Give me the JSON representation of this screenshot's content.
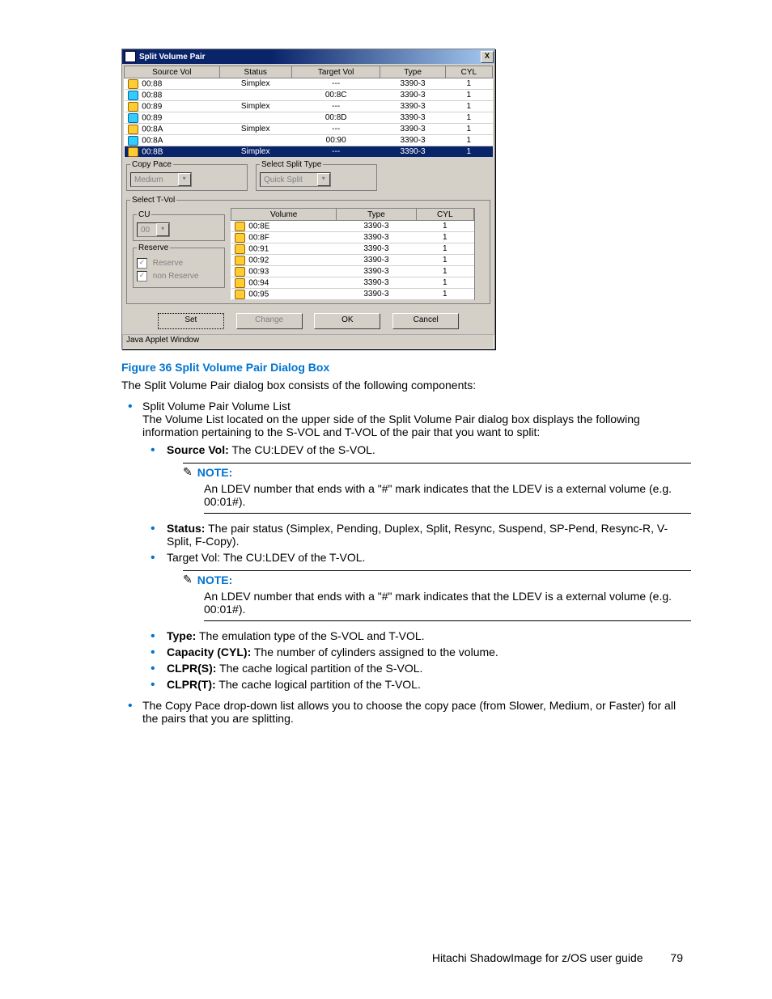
{
  "dialog": {
    "title": "Split Volume Pair",
    "close_x": "X",
    "statusbar": "Java Applet Window",
    "top_headers": [
      "Source Vol",
      "Status",
      "Target Vol",
      "Type",
      "CYL"
    ],
    "top_rows": [
      {
        "icon": "y",
        "src": "00:88",
        "status": "Simplex",
        "tgt": "---",
        "type": "3390-3",
        "cyl": "1",
        "sel": false
      },
      {
        "icon": "b",
        "src": "00:88",
        "status": "",
        "tgt": "00:8C",
        "type": "3390-3",
        "cyl": "1",
        "sel": false
      },
      {
        "icon": "y",
        "src": "00:89",
        "status": "Simplex",
        "tgt": "---",
        "type": "3390-3",
        "cyl": "1",
        "sel": false
      },
      {
        "icon": "b",
        "src": "00:89",
        "status": "",
        "tgt": "00:8D",
        "type": "3390-3",
        "cyl": "1",
        "sel": false
      },
      {
        "icon": "y",
        "src": "00:8A",
        "status": "Simplex",
        "tgt": "---",
        "type": "3390-3",
        "cyl": "1",
        "sel": false
      },
      {
        "icon": "b",
        "src": "00:8A",
        "status": "",
        "tgt": "00:90",
        "type": "3390-3",
        "cyl": "1",
        "sel": false
      },
      {
        "icon": "y",
        "src": "00:8B",
        "status": "Simplex",
        "tgt": "---",
        "type": "3390-3",
        "cyl": "1",
        "sel": true
      }
    ],
    "copy_pace": {
      "legend": "Copy Pace",
      "value": "Medium"
    },
    "split_type": {
      "legend": "Select Split Type",
      "value": "Quick Split"
    },
    "select_tvol_legend": "Select T-Vol",
    "cu": {
      "legend": "CU",
      "value": "00"
    },
    "reserve": {
      "legend": "Reserve",
      "opt1": "Reserve",
      "opt2": "non Reserve"
    },
    "vol_headers": [
      "Volume",
      "Type",
      "CYL"
    ],
    "vol_rows": [
      {
        "v": "00:8E",
        "t": "3390-3",
        "c": "1"
      },
      {
        "v": "00:8F",
        "t": "3390-3",
        "c": "1"
      },
      {
        "v": "00:91",
        "t": "3390-3",
        "c": "1"
      },
      {
        "v": "00:92",
        "t": "3390-3",
        "c": "1"
      },
      {
        "v": "00:93",
        "t": "3390-3",
        "c": "1"
      },
      {
        "v": "00:94",
        "t": "3390-3",
        "c": "1"
      },
      {
        "v": "00:95",
        "t": "3390-3",
        "c": "1"
      }
    ],
    "buttons": {
      "set": "Set",
      "change": "Change",
      "ok": "OK",
      "cancel": "Cancel"
    }
  },
  "doc": {
    "fig_caption": "Figure 36 Split Volume Pair Dialog Box",
    "intro": "The Split Volume Pair dialog box consists of the following components:",
    "b1_item1_l1": "Split Volume Pair Volume List",
    "b1_item1_l2": "The Volume List located on the upper side of the Split Volume Pair dialog box displays the following information pertaining to the S-VOL and T-VOL of the pair that you want to split:",
    "field_source_label": "Source Vol:",
    "field_source_text": " The CU:LDEV of the S-VOL.",
    "note_label": "NOTE:",
    "note1_text": "An LDEV number that ends with a \"#\" mark indicates that the LDEV is a external volume (e.g. 00:01#).",
    "field_status_label": "Status:",
    "field_status_text": " The pair status (Simplex, Pending, Duplex, Split, Resync, Suspend, SP-Pend, Resync-R, V-Split, F-Copy).",
    "field_target_text": "Target Vol:  The CU:LDEV of the T-VOL.",
    "note2_text": "An LDEV number that ends with a \"#\" mark indicates that the LDEV is a external volume (e.g.  00:01#).",
    "field_type_label": "Type:",
    "field_type_text": " The emulation type of the S-VOL and T-VOL.",
    "field_cap_label": "Capacity (CYL):",
    "field_cap_text": " The number of cylinders assigned to the volume.",
    "field_clprs_label": "CLPR(S):",
    "field_clprs_text": " The cache logical partition of the S-VOL.",
    "field_clprt_label": "CLPR(T):",
    "field_clprt_text": " The cache logical partition of the T-VOL.",
    "b1_item2": "The Copy Pace drop-down list allows you to choose the copy pace (from Slower, Medium, or Faster) for all the pairs that you are splitting."
  },
  "footer": {
    "text": "Hitachi ShadowImage for z/OS user guide",
    "page": "79"
  }
}
